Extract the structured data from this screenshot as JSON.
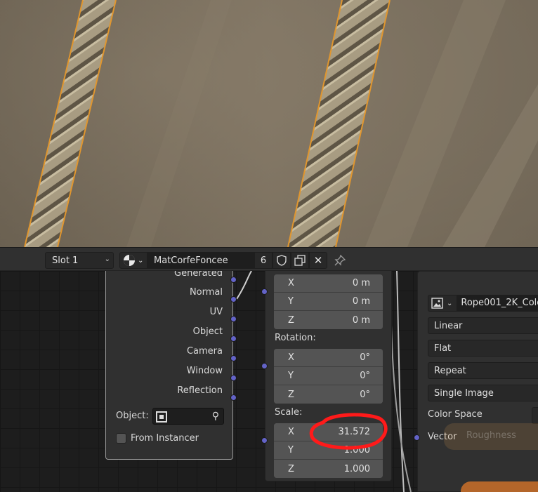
{
  "header": {
    "slot_label": "Slot 1",
    "material_name": "MatCorfeFoncee",
    "user_count": "6"
  },
  "tex_coord_node": {
    "outputs": [
      "Generated",
      "Normal",
      "UV",
      "Object",
      "Camera",
      "Window",
      "Reflection"
    ],
    "object_label": "Object:",
    "from_instancer_label": "From Instancer"
  },
  "mapping_node": {
    "location": [
      {
        "axis": "X",
        "value": "0 m"
      },
      {
        "axis": "Y",
        "value": "0 m"
      },
      {
        "axis": "Z",
        "value": "0 m"
      }
    ],
    "rotation_label": "Rotation:",
    "rotation": [
      {
        "axis": "X",
        "value": "0°"
      },
      {
        "axis": "Y",
        "value": "0°"
      },
      {
        "axis": "Z",
        "value": "0°"
      }
    ],
    "scale_label": "Scale:",
    "scale": [
      {
        "axis": "X",
        "value": "31.572"
      },
      {
        "axis": "Y",
        "value": "1.000"
      },
      {
        "axis": "Z",
        "value": "1.000"
      }
    ]
  },
  "image_texture_node": {
    "image_name": "Rope001_2K_Colo",
    "interpolation": "Linear",
    "projection": "Flat",
    "extension": "Repeat",
    "source": "Single Image",
    "color_space_label": "Color Space",
    "vector_label": "Vector",
    "ghost_label": "Roughness"
  },
  "colors": {
    "accent_socket": "#6363c7",
    "selection_outline": "#e0962f",
    "annotation": "#ff1a1a"
  }
}
